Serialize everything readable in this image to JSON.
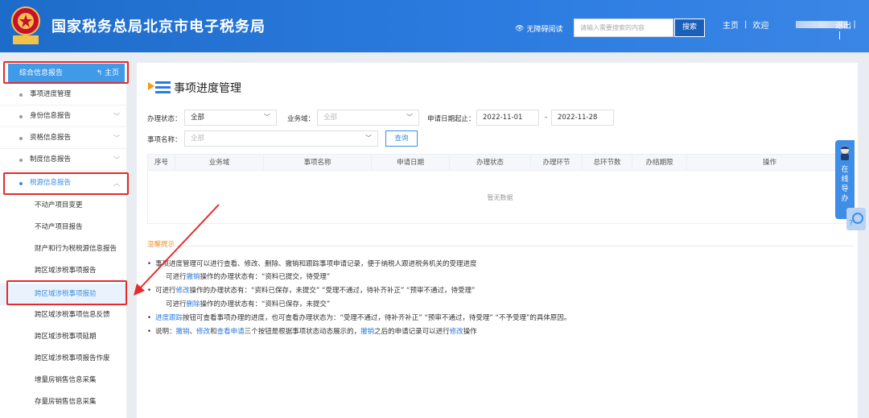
{
  "header": {
    "title": "国家税务总局北京市电子税务局",
    "logo_text": "中国税务",
    "accessibility": "无障碍阅读",
    "search_placeholder": "请输入需要搜索的内容",
    "search_button": "搜索",
    "home": "主页",
    "welcome": "欢迎",
    "logout": "退出",
    "colors": {
      "header_bg": "#2b7be0",
      "accent": "#3a8ee6",
      "highlight_box": "#e52b2b"
    }
  },
  "sidebar": {
    "top_item": "综合信息报告",
    "home_link": "主页",
    "items": [
      {
        "label": "事项进度管理",
        "chevron": ""
      },
      {
        "label": "身份信息报告",
        "chevron": "﹀"
      },
      {
        "label": "资格信息报告",
        "chevron": "﹀"
      },
      {
        "label": "制度信息报告",
        "chevron": "﹀"
      },
      {
        "label": "税源信息报告",
        "chevron": "︿"
      }
    ],
    "sub_items": [
      "不动产项目变更",
      "不动产项目报告",
      "财产和行为税税源信息报告",
      "跨区域涉税事项报告",
      "跨区域涉税事项报验",
      "跨区域涉税事项信息反馈",
      "跨区域涉税事项延期",
      "跨区域涉税事项报告作废",
      "增量房销售信息采集",
      "存量房销售信息采集"
    ],
    "active_item_index": 4,
    "active_sub_index": 4
  },
  "main": {
    "title": "事项进度管理",
    "filters": {
      "status_label": "办理状态：",
      "status_value": "全部",
      "domain_label": "业务域：",
      "domain_value": "全部",
      "date_label": "申请日期起止：",
      "date_from": "2022-11-01",
      "date_sep": "-",
      "date_to": "2022-11-28",
      "name_label": "事项名称：",
      "name_value": "全部",
      "query_button": "查询"
    },
    "table": {
      "columns": [
        "序号",
        "业务域",
        "事项名称",
        "申请日期",
        "办理状态",
        "办理环节",
        "总环节数",
        "办结期限",
        "操作"
      ],
      "empty_text": "暂无数据"
    },
    "tips": {
      "title": "温馨提示",
      "l1": "事项进度管理可以进行查看、修改、删除、撤销和跟踪事项申请记录，便于纳税人跟进税务机关的受理进度",
      "l2a": "可进行",
      "l2b": "撤销",
      "l2c": "操作的办理状态有：“资料已提交，待受理”",
      "l3a": "可进行",
      "l3b": "修改",
      "l3c": "操作的办理状态有：“资料已保存，未提交” “受理不通过，待补齐补正” “预审不通过，待受理”",
      "l4a": "可进行",
      "l4b": "删除",
      "l4c": "操作的办理状态有：“资料已保存，未提交”",
      "l5a": "进度跟踪",
      "l5b": "按钮可查看事项办理的进度，也可查看办理状态为：“受理不通过，待补齐补正” “预审不通过，待受理” “不予受理”的具体原因。",
      "l6a": "说明：",
      "l6b": "撤销",
      "l6c": "、",
      "l6d": "修改",
      "l6e": "和",
      "l6f": "查看申请",
      "l6g": "三个按钮是根据事项状态动态展示的，",
      "l6h": "撤销",
      "l6i": "之后的申请记录可以进行",
      "l6j": "修改",
      "l6k": "操作"
    }
  },
  "float": {
    "chars": [
      "在",
      "线",
      "导",
      "办"
    ]
  }
}
